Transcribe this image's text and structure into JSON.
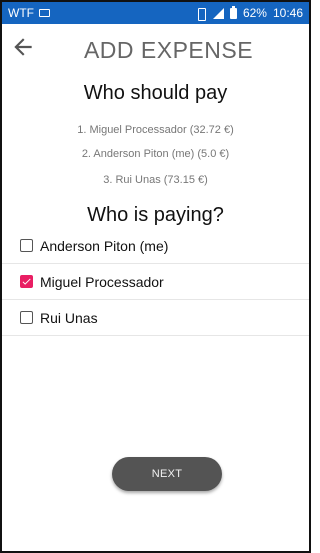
{
  "status_bar": {
    "carrier": "WTF",
    "battery_percent": "62%",
    "time": "10:46"
  },
  "header": {
    "title": "ADD EXPENSE"
  },
  "who_should_pay": {
    "heading": "Who should pay",
    "items": [
      "1. Miguel Processador (32.72 €)",
      "2. Anderson Piton (me) (5.0 €)",
      "3. Rui Unas (73.15 €)"
    ]
  },
  "who_is_paying": {
    "heading": "Who is paying?",
    "options": [
      {
        "label": "Anderson Piton (me)",
        "checked": false
      },
      {
        "label": "Miguel Processador",
        "checked": true
      },
      {
        "label": "Rui Unas",
        "checked": false
      }
    ]
  },
  "actions": {
    "next_label": "NEXT"
  },
  "colors": {
    "status_bar": "#1565c0",
    "checkbox_checked": "#e91e63",
    "next_button": "#545454"
  }
}
